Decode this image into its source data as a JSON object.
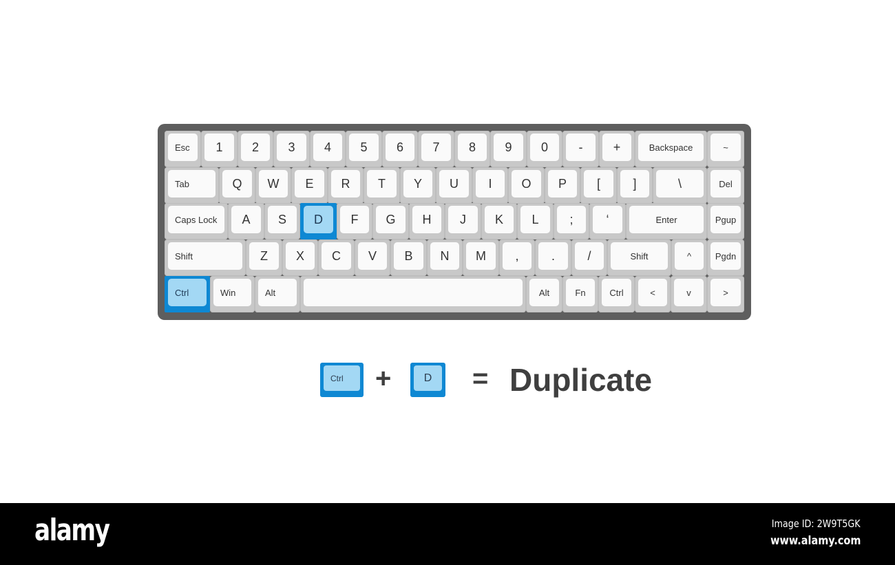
{
  "keyboard": {
    "rows": [
      [
        {
          "label": "Esc",
          "size": "small"
        },
        {
          "label": "1"
        },
        {
          "label": "2"
        },
        {
          "label": "3"
        },
        {
          "label": "4"
        },
        {
          "label": "5"
        },
        {
          "label": "6"
        },
        {
          "label": "7"
        },
        {
          "label": "8"
        },
        {
          "label": "9"
        },
        {
          "label": "0"
        },
        {
          "label": "-"
        },
        {
          "label": "+"
        },
        {
          "label": "Backspace",
          "size": "small-center"
        },
        {
          "label": "~",
          "size": "small-center"
        }
      ],
      [
        {
          "label": "Tab",
          "size": "small"
        },
        {
          "label": "Q"
        },
        {
          "label": "W"
        },
        {
          "label": "E"
        },
        {
          "label": "R"
        },
        {
          "label": "T"
        },
        {
          "label": "Y"
        },
        {
          "label": "U"
        },
        {
          "label": "I"
        },
        {
          "label": "O"
        },
        {
          "label": "P"
        },
        {
          "label": "["
        },
        {
          "label": "]"
        },
        {
          "label": "\\"
        },
        {
          "label": "Del",
          "size": "small-center"
        }
      ],
      [
        {
          "label": "Caps Lock",
          "size": "small"
        },
        {
          "label": "A"
        },
        {
          "label": "S"
        },
        {
          "label": "D",
          "highlighted": true
        },
        {
          "label": "F"
        },
        {
          "label": "G"
        },
        {
          "label": "H"
        },
        {
          "label": "J"
        },
        {
          "label": "K"
        },
        {
          "label": "L"
        },
        {
          "label": ";"
        },
        {
          "label": "‘"
        },
        {
          "label": "Enter",
          "size": "small-center"
        },
        {
          "label": "Pgup",
          "size": "small-center"
        }
      ],
      [
        {
          "label": "Shift",
          "size": "small"
        },
        {
          "label": "Z"
        },
        {
          "label": "X"
        },
        {
          "label": "C"
        },
        {
          "label": "V"
        },
        {
          "label": "B"
        },
        {
          "label": "N"
        },
        {
          "label": "M"
        },
        {
          "label": ","
        },
        {
          "label": "."
        },
        {
          "label": "/"
        },
        {
          "label": "Shift",
          "size": "small-center"
        },
        {
          "label": "^",
          "size": "small-center"
        },
        {
          "label": "Pgdn",
          "size": "small-center"
        }
      ],
      [
        {
          "label": "Ctrl",
          "size": "small",
          "highlighted": true
        },
        {
          "label": "Win",
          "size": "small"
        },
        {
          "label": "Alt",
          "size": "small"
        },
        {
          "label": ""
        },
        {
          "label": "Alt",
          "size": "small-center"
        },
        {
          "label": "Fn",
          "size": "small-center"
        },
        {
          "label": "Ctrl",
          "size": "small-center"
        },
        {
          "label": "<",
          "size": "small-center"
        },
        {
          "label": "v",
          "size": "small-center"
        },
        {
          "label": ">",
          "size": "small-center"
        }
      ]
    ]
  },
  "shortcut": {
    "key1": "Ctrl",
    "plus": "+",
    "key2": "D",
    "equals": "=",
    "action": "Duplicate"
  },
  "colors": {
    "highlight_border": "#0e88d3",
    "highlight_fill": "#a3d8f4",
    "frame": "#5e5e5e",
    "key_base": "#c8c8c8",
    "key_top": "#fafafa",
    "text": "#3f3f3f"
  },
  "footer": {
    "brand": "alamy",
    "image_id": "Image ID: 2W9T5GK",
    "site": "www.alamy.com"
  }
}
